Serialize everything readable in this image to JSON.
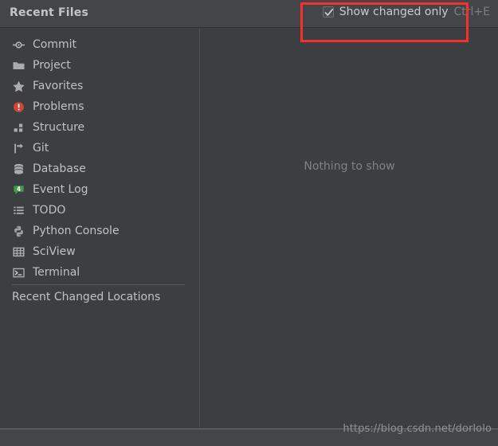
{
  "window": {
    "title": "Recent Files"
  },
  "header": {
    "checkbox": {
      "label": "Show changed only",
      "shortcut": "Ctrl+E",
      "checked": "true",
      "icon": "checkmark-icon"
    }
  },
  "sidebar": {
    "items": [
      {
        "label": "Commit",
        "icon": "commit-icon"
      },
      {
        "label": "Project",
        "icon": "folder-icon"
      },
      {
        "label": "Favorites",
        "icon": "star-icon"
      },
      {
        "label": "Problems",
        "icon": "error-circle-icon"
      },
      {
        "label": "Structure",
        "icon": "structure-icon"
      },
      {
        "label": "Git",
        "icon": "git-branch-icon"
      },
      {
        "label": "Database",
        "icon": "database-icon"
      },
      {
        "label": "Event Log",
        "icon": "event-log-badge-icon",
        "badge": "4"
      },
      {
        "label": "TODO",
        "icon": "todo-list-icon"
      },
      {
        "label": "Python Console",
        "icon": "python-icon"
      },
      {
        "label": "SciView",
        "icon": "sciview-grid-icon"
      },
      {
        "label": "Terminal",
        "icon": "terminal-icon"
      }
    ],
    "footer_item": {
      "label": "Recent Changed Locations"
    }
  },
  "main": {
    "empty_message": "Nothing to show"
  },
  "watermark": {
    "text": "https://blog.csdn.net/dorlolo"
  },
  "colors": {
    "background": "#3c3f41",
    "titlebar": "#434649",
    "text": "#bfc2c5",
    "muted_text": "#7e8286",
    "annotation": "#fc2d2d",
    "problem_red": "#d0453b",
    "event_green": "#459c48"
  }
}
